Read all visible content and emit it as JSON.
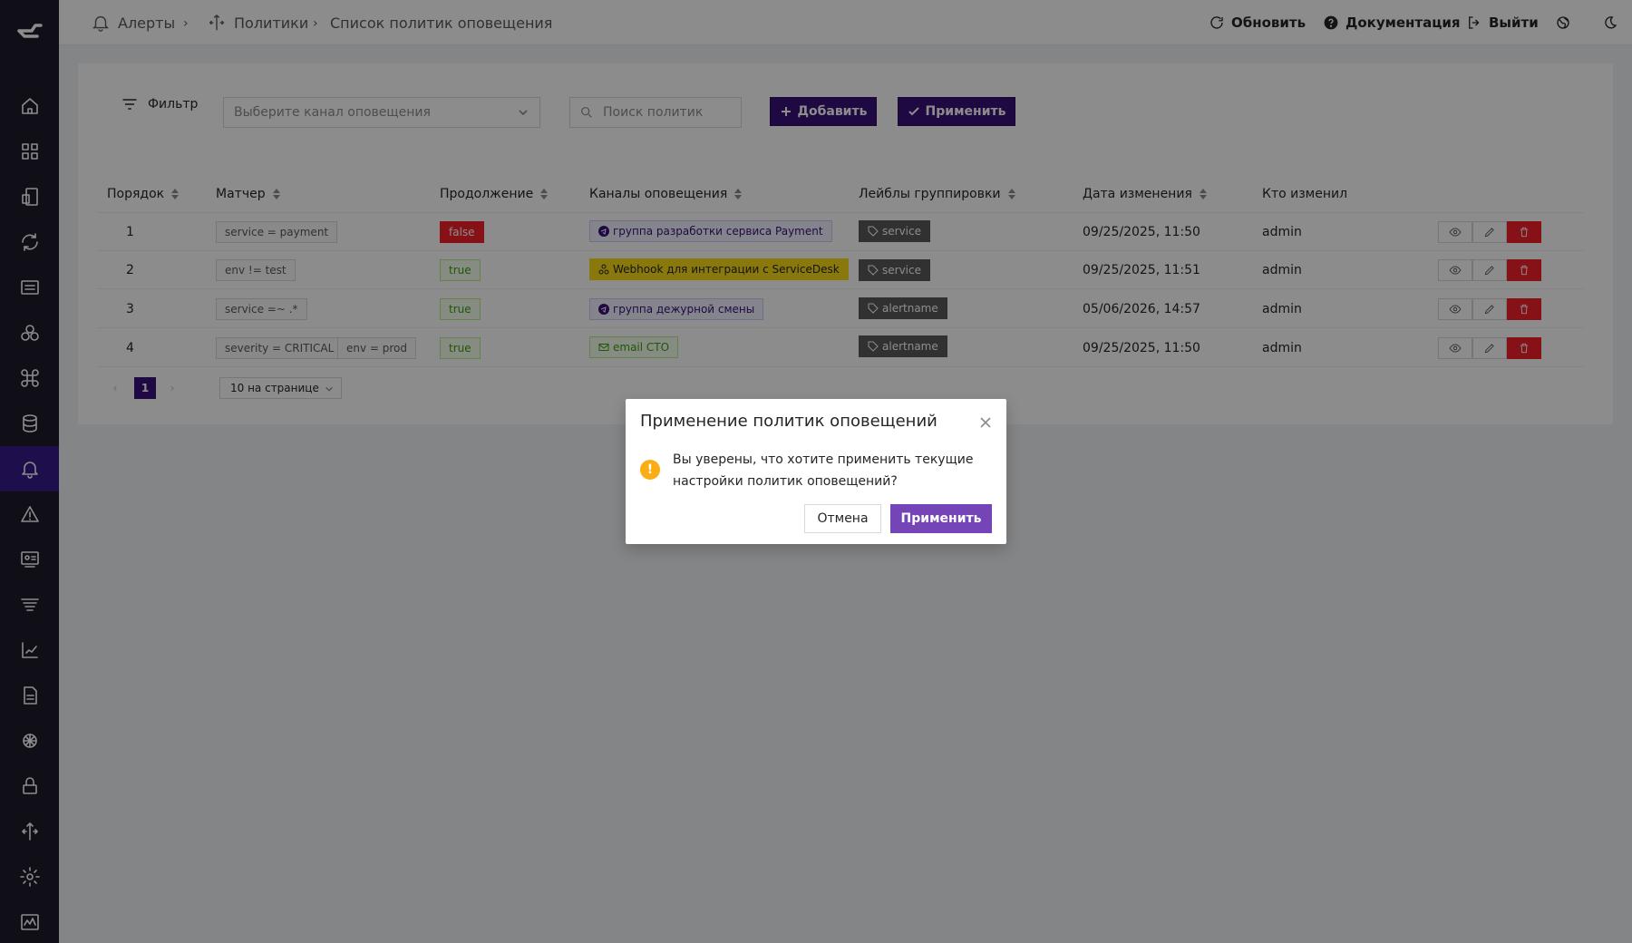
{
  "breadcrumb": {
    "items": [
      "Алерты",
      "Политики",
      "Список политик оповещения"
    ]
  },
  "header": {
    "refresh_label": "Обновить",
    "docs_label": "Документация",
    "logout_label": "Выйти"
  },
  "sidebar": {
    "items": [
      {
        "icon": "home-icon"
      },
      {
        "icon": "dashboards-icon"
      },
      {
        "icon": "objects-icon"
      },
      {
        "icon": "sync-icon"
      },
      {
        "icon": "table-icon"
      },
      {
        "icon": "services-icon"
      },
      {
        "icon": "command-icon"
      },
      {
        "icon": "database-icon"
      },
      {
        "icon": "bell-icon",
        "active": true
      },
      {
        "icon": "warning-icon"
      },
      {
        "icon": "reports-icon"
      },
      {
        "icon": "filters-icon"
      },
      {
        "icon": "chart-icon"
      },
      {
        "icon": "document-icon"
      },
      {
        "icon": "network-icon"
      },
      {
        "icon": "lock-icon"
      },
      {
        "icon": "routing-icon"
      },
      {
        "icon": "settings-icon"
      },
      {
        "icon": "monitoring-icon"
      }
    ]
  },
  "filter": {
    "label": "Фильтр",
    "channel_placeholder": "Выберите канал оповещения",
    "search_placeholder": "Поиск политик",
    "add_label": "Добавить",
    "apply_label": "Применить"
  },
  "table": {
    "columns": [
      "Порядок",
      "Матчер",
      "Продолжение",
      "Каналы оповещения",
      "Лейблы группировки",
      "Дата изменения",
      "Кто изменил"
    ],
    "rows": [
      {
        "order": "1",
        "matchers": [
          "service = payment"
        ],
        "continue": "false",
        "channel": {
          "label": "группа разработки сервиса Payment",
          "kind": "telegram"
        },
        "label": "service",
        "date": "09/25/2025, 11:50",
        "author": "admin"
      },
      {
        "order": "2",
        "matchers": [
          "env != test"
        ],
        "continue": "true",
        "channel": {
          "label": "Webhook для интеграции с ServiceDesk",
          "kind": "webhook"
        },
        "label": "service",
        "date": "09/25/2025, 11:51",
        "author": "admin"
      },
      {
        "order": "3",
        "matchers": [
          "service =~ .*"
        ],
        "continue": "true",
        "channel": {
          "label": "группа дежурной смены",
          "kind": "telegram"
        },
        "label": "alertname",
        "date": "05/06/2026, 14:57",
        "author": "admin"
      },
      {
        "order": "4",
        "matchers": [
          "severity = CRITICAL",
          "env = prod"
        ],
        "continue": "true",
        "channel": {
          "label": "email CTO",
          "kind": "email"
        },
        "label": "alertname",
        "date": "09/25/2025, 11:50",
        "author": "admin"
      }
    ]
  },
  "pagination": {
    "current_page": "1",
    "page_size_label": "10 на странице"
  },
  "modal": {
    "title": "Применение политик оповещений",
    "message": "Вы уверены, что хотите применить текущие настройки политик оповещений?",
    "cancel_label": "Отмена",
    "ok_label": "Применить"
  },
  "colors": {
    "sidebar_bg": "#1e1a2b",
    "primary": "#3a1278",
    "modal_ok": "#7545b8",
    "danger": "#f5222d",
    "warning": "#faad14"
  }
}
